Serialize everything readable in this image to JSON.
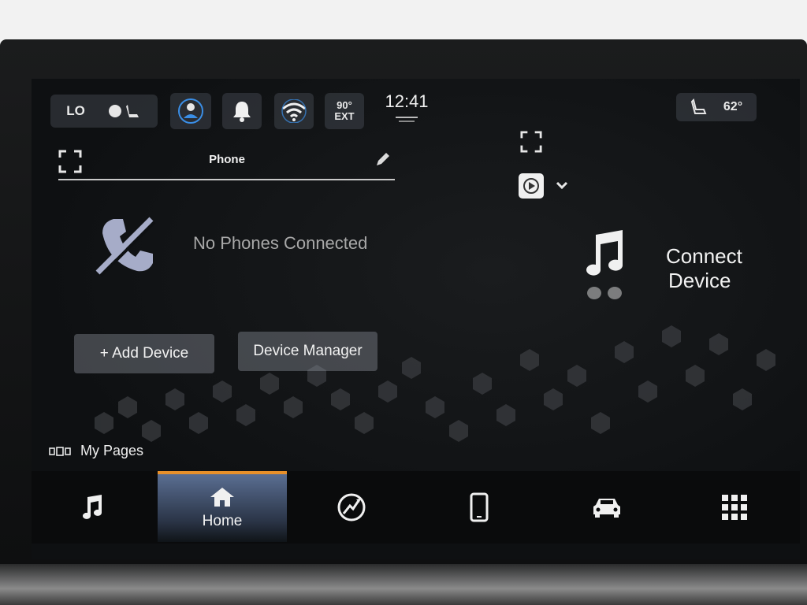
{
  "status_bar": {
    "fan_level": "LO",
    "outside_temp": "90°",
    "outside_label": "EXT",
    "clock": "12:41",
    "cabin_temp": "62°"
  },
  "phone_widget": {
    "title": "Phone",
    "message": "No Phones Connected",
    "add_device_label": "+ Add Device",
    "device_manager_label": "Device Manager"
  },
  "media_widget": {
    "line1": "Connect",
    "line2": "Device"
  },
  "my_pages": {
    "label": "My Pages"
  },
  "bottom_nav": {
    "home_label": "Home",
    "active": "home",
    "items": [
      "music-icon",
      "home-icon",
      "nav-compass-icon",
      "phone-icon",
      "vehicle-icon",
      "apps-grid-icon"
    ]
  },
  "colors": {
    "accent_orange": "#e8902a",
    "wifi_blue": "#3a8ee6",
    "home_tab_blue": "#5a6e92"
  }
}
